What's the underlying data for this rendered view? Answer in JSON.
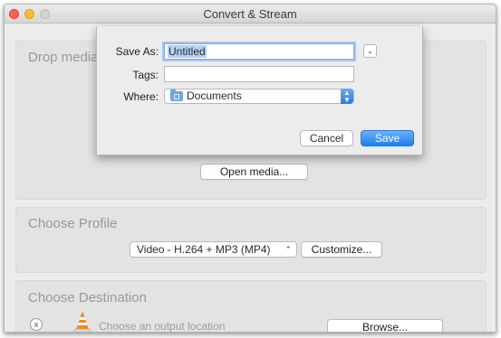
{
  "window": {
    "title": "Convert & Stream"
  },
  "drop_panel": {
    "title": "Drop media",
    "open_button": "Open media..."
  },
  "profile_panel": {
    "title": "Choose Profile",
    "selected_profile": "Video - H.264 + MP3 (MP4)",
    "customize_button": "Customize..."
  },
  "destination_panel": {
    "title": "Choose Destination",
    "remove_label": "x",
    "location_placeholder": "Choose an output location",
    "browse_button": "Browse..."
  },
  "save_sheet": {
    "save_as_label": "Save As:",
    "save_as_value": "Untitled",
    "tags_label": "Tags:",
    "tags_value": "",
    "where_label": "Where:",
    "where_value": "Documents",
    "cancel_button": "Cancel",
    "save_button": "Save"
  },
  "icons": {
    "expand": "chevron-down-icon",
    "folder": "folder-icon",
    "stepper": "up-down-arrows-icon",
    "cone": "vlc-cone-icon"
  },
  "colors": {
    "accent": "#1c7ef3",
    "selection": "#b4d2f6"
  }
}
